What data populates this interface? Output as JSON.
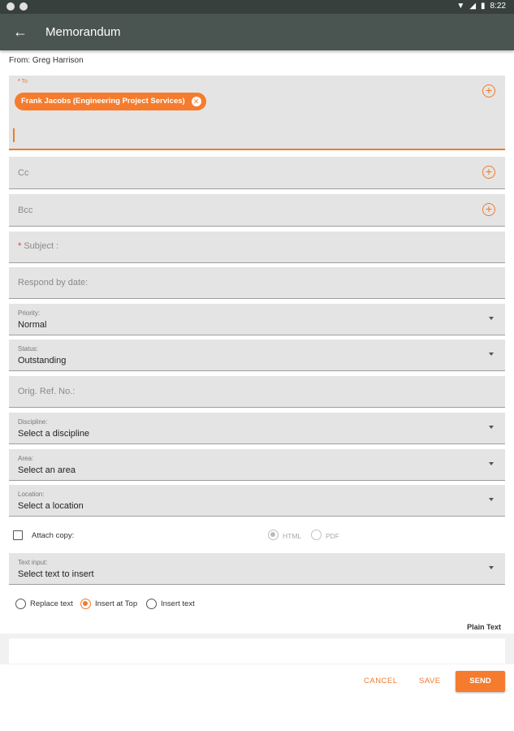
{
  "status_bar": {
    "time": "8:22"
  },
  "app_bar": {
    "title": "Memorandum"
  },
  "from_line": "From: Greg Harrison",
  "to": {
    "label": "To",
    "recipients": [
      "Frank Jacobs (Engineering Project Services)"
    ]
  },
  "cc": {
    "placeholder": "Cc"
  },
  "bcc": {
    "placeholder": "Bcc"
  },
  "subject": {
    "label": "Subject :"
  },
  "respond_by": {
    "placeholder": "Respond by date:"
  },
  "priority": {
    "label": "Priority:",
    "value": "Normal"
  },
  "status": {
    "label": "Status:",
    "value": "Outstanding"
  },
  "orig_ref": {
    "placeholder": "Orig. Ref. No.:"
  },
  "discipline": {
    "label": "Discipline:",
    "value": "Select a discipline"
  },
  "area": {
    "label": "Area:",
    "value": "Select an area"
  },
  "location": {
    "label": "Location:",
    "value": "Select a location"
  },
  "attach": {
    "label": "Attach copy:",
    "checked": false,
    "formats": [
      "HTML",
      "PDF"
    ],
    "selected_format": "HTML"
  },
  "text_input": {
    "label": "Text input:",
    "value": "Select text to insert"
  },
  "insert_options": {
    "items": [
      "Replace text",
      "Insert at Top",
      "Insert text"
    ],
    "selected": "Insert at Top"
  },
  "editor_mode": "Plain Text",
  "actions": {
    "cancel": "CANCEL",
    "save": "SAVE",
    "send": "SEND"
  },
  "colors": {
    "accent": "#f57c2e",
    "app_bar": "#4a5450",
    "field_bg": "#e4e4e4"
  },
  "icons": [
    "back-arrow-icon",
    "add-circle-icon",
    "chip-remove-icon",
    "dropdown-arrow-icon",
    "wifi-icon",
    "battery-icon"
  ]
}
